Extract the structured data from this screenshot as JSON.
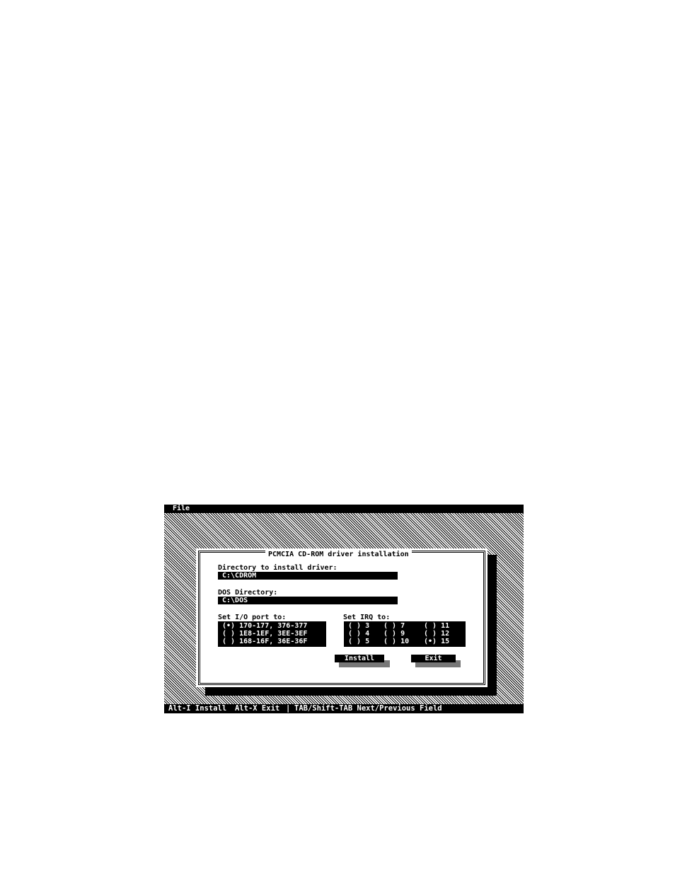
{
  "menubar": {
    "file": "File"
  },
  "dialog": {
    "title": "PCMCIA CD-ROM driver installation",
    "install_dir_label": "Directory to install driver:",
    "install_dir_value": "C:\\CDROM",
    "dos_dir_label": "DOS Directory:",
    "dos_dir_value": "C:\\DOS",
    "io_label": "Set I/O port to:",
    "io_options": [
      "(•) 170-177, 376-377",
      "( ) 1E8-1EF, 3EE-3EF",
      "( ) 168-16F, 36E-36F"
    ],
    "irq_label": "Set IRQ to:",
    "irq_options": [
      "( ) 3",
      "( ) 7",
      "( ) 11",
      "( ) 4",
      "( ) 9",
      "( ) 12",
      "( ) 5",
      "( ) 10",
      "(•) 15"
    ],
    "install_button": "Install",
    "exit_button": "Exit"
  },
  "statusbar": {
    "install_hint": "Alt-I Install",
    "exit_hint": "Alt-X Exit",
    "separator": "|",
    "nav_hint": "TAB/Shift-TAB Next/Previous Field"
  }
}
